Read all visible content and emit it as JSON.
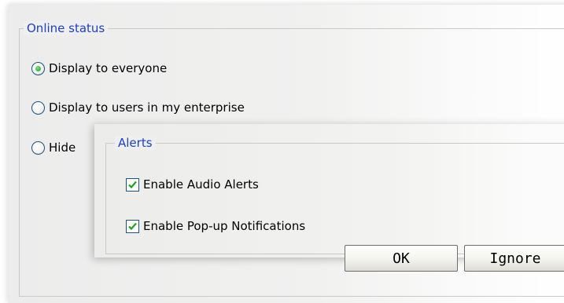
{
  "online_status": {
    "legend": "Online status",
    "options": [
      {
        "label": "Display to everyone",
        "checked": true
      },
      {
        "label": "Display to users in my enterprise",
        "checked": false
      },
      {
        "label": "Hide",
        "checked": false
      }
    ]
  },
  "alerts": {
    "legend": "Alerts",
    "options": [
      {
        "label": "Enable Audio Alerts",
        "checked": true
      },
      {
        "label": "Enable Pop-up Notifications",
        "checked": true
      }
    ]
  },
  "buttons": {
    "ok": "OK",
    "ignore": "Ignore"
  },
  "colors": {
    "legend_text": "#1c3ec8",
    "radio_selected": "#21a121",
    "checkmark": "#21a121"
  }
}
